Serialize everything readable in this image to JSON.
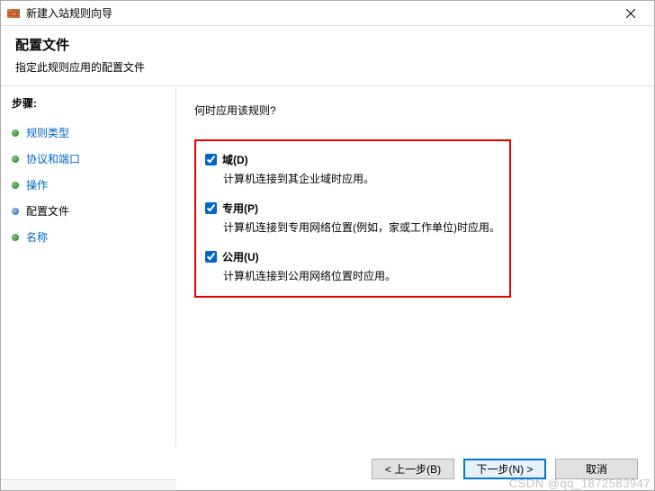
{
  "window": {
    "title": "新建入站规则向导"
  },
  "header": {
    "title": "配置文件",
    "subtitle": "指定此规则应用的配置文件"
  },
  "sidebar": {
    "title": "步骤:",
    "items": [
      {
        "label": "规则类型",
        "state": "done"
      },
      {
        "label": "协议和端口",
        "state": "done"
      },
      {
        "label": "操作",
        "state": "done"
      },
      {
        "label": "配置文件",
        "state": "current"
      },
      {
        "label": "名称",
        "state": "done"
      }
    ]
  },
  "content": {
    "question": "何时应用该规则?",
    "options": [
      {
        "title": "域(D)",
        "desc": "计算机连接到其企业域时应用。",
        "checked": true
      },
      {
        "title": "专用(P)",
        "desc": "计算机连接到专用网络位置(例如，家或工作单位)时应用。",
        "checked": true
      },
      {
        "title": "公用(U)",
        "desc": "计算机连接到公用网络位置时应用。",
        "checked": true
      }
    ]
  },
  "footer": {
    "back": "< 上一步(B)",
    "next": "下一步(N) >",
    "cancel": "取消"
  },
  "watermark": "CSDN @qq_1872583947"
}
